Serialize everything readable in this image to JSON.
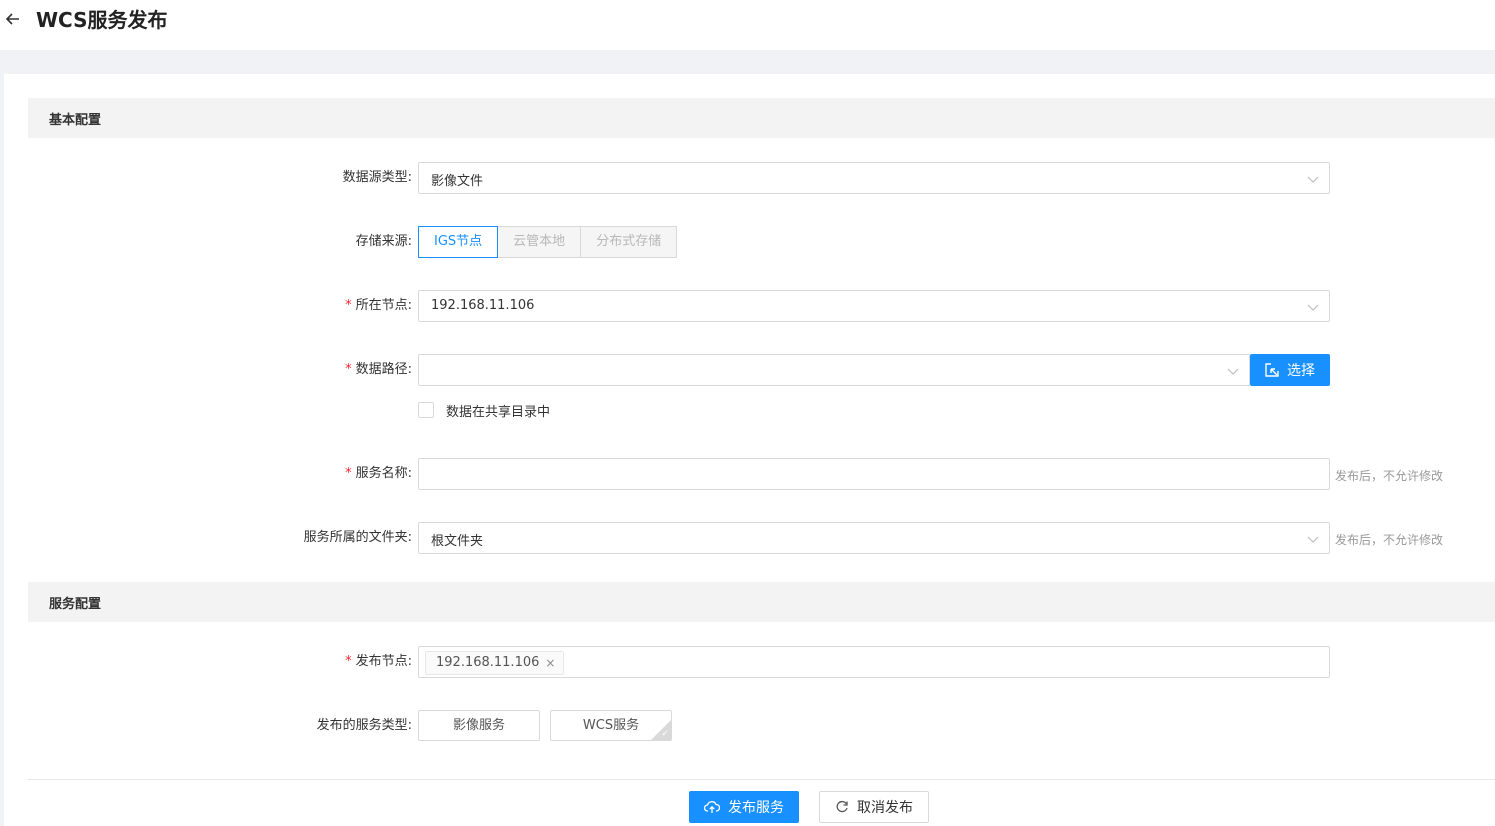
{
  "header": {
    "title": "WCS服务发布"
  },
  "sections": {
    "basic": "基本配置",
    "service": "服务配置"
  },
  "fields": {
    "datasource_type": {
      "label": "数据源类型:",
      "value": "影像文件"
    },
    "storage_source": {
      "label": "存储来源:",
      "options": [
        "IGS节点",
        "云管本地",
        "分布式存储"
      ],
      "selected": "IGS节点"
    },
    "node": {
      "label": "所在节点:",
      "value": "192.168.11.106"
    },
    "data_path": {
      "label": "数据路径:",
      "value": "",
      "select_button": "选择"
    },
    "shared_dir": {
      "label": "数据在共享目录中",
      "checked": false
    },
    "service_name": {
      "label": "服务名称:",
      "value": "",
      "hint": "发布后，不允许修改"
    },
    "folder": {
      "label": "服务所属的文件夹:",
      "value": "根文件夹",
      "hint": "发布后，不允许修改"
    },
    "publish_node": {
      "label": "发布节点:",
      "tags": [
        "192.168.11.106"
      ]
    },
    "service_types": {
      "label": "发布的服务类型:",
      "options": [
        "影像服务",
        "WCS服务"
      ],
      "selected": "WCS服务"
    }
  },
  "footer": {
    "publish": "发布服务",
    "cancel": "取消发布"
  },
  "colors": {
    "primary": "#1890ff",
    "required": "#f5222d",
    "section_bg": "#f3f3f3",
    "band_bg": "#f0f2f5"
  },
  "icons": [
    "arrow-left-icon",
    "chevron-down-icon",
    "select-file-icon",
    "cloud-upload-icon",
    "undo-icon",
    "close-icon",
    "check-icon"
  ]
}
